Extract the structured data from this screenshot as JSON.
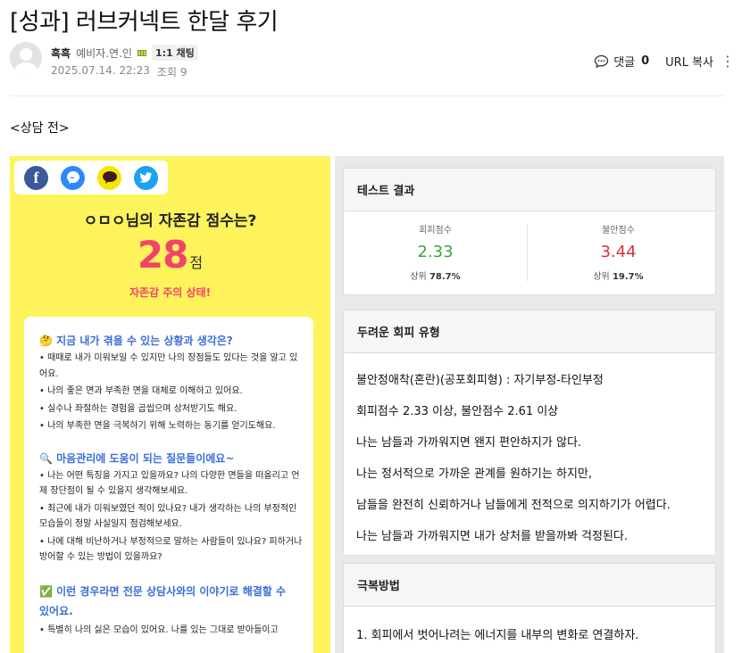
{
  "post": {
    "title": "[성과] 러브커넥트 한달 후기",
    "author": "흑흑",
    "grade": "예비자.연.인",
    "chat_badge": "1:1 채팅",
    "date": "2025.07.14. 22:23",
    "views": "조회 9",
    "comments_label": "댓글",
    "comments_count": "0",
    "url_copy": "URL 복사",
    "section_label": "<상담 전>"
  },
  "left_panel": {
    "score_title": "ㅇㅁㅇ님의 자존감 점수는?",
    "score": "28",
    "score_unit": "점",
    "state": "자존감 주의 상태!",
    "sections": [
      {
        "emoji": "🤔",
        "heading": "지금 내가 겪을 수 있는 상황과 생각은?",
        "lines": [
          "• 때때로 내가 미워보일 수 있지만 나의 장점들도 있다는 것을 알고 있어요.",
          "• 나의 좋은 면과 부족한 면을 대체로 이해하고 있어요.",
          "• 실수나 좌절하는 경험을 곱씹으며 상처받기도 해요.",
          "• 나의 부족한 면을 극복하기 위해 노력하는 동기를 얻기도해요."
        ]
      },
      {
        "emoji": "🔍",
        "heading": "마음관리에 도움이 되는 질문들이에요~",
        "lines": [
          "• 나는 어떤 특징을 가지고 있을까요? 나의 다양한 면들을 떠올리고 언제 장단점이 될 수 있을지 생각해보세요.",
          "• 최근에 내가 미워보였던 적이 있나요? 내가 생각하는 나의 부정적인 모습들이 정말 사실일지 점검해보세요.",
          "• 나에 대해 비난하거나 부정적으로 말하는 사람들이 있나요? 피하거나 방어할 수 있는 방법이 있을까요?"
        ]
      },
      {
        "emoji": "✅",
        "heading": "이런 경우라면 전문 상담사와의 이야기로 해결할 수 있어요.",
        "lines": [
          "• 특별히 나의 싫은 모습이 있어요. 나를 있는 그대로 받아들이고"
        ]
      }
    ]
  },
  "right_panel": {
    "test_result": {
      "title": "테스트 결과",
      "avoid": {
        "label": "회피점수",
        "value": "2.33",
        "rank_prefix": "상위",
        "rank": "78.7%"
      },
      "anxiety": {
        "label": "불안점수",
        "value": "3.44",
        "rank_prefix": "상위",
        "rank": "19.7%"
      }
    },
    "type_box": {
      "title": "두려운 회피 유형",
      "lines": [
        "불안정애착(혼란)(공포회피형) : 자기부정-타인부정",
        "회피점수 2.33 이상, 불안점수 2.61 이상",
        "나는 남들과 가까워지면 왠지 편안하지가 않다.",
        "나는 정서적으로 가까운 관계를 원하기는 하지만,",
        "남들을 완전히 신뢰하거나 남들에게 전적으로 의지하기가 어렵다.",
        "나는 남들과 가까워지면 내가 상처를 받을까봐 걱정된다."
      ]
    },
    "overcome_box": {
      "title": "극복방법",
      "lines": [
        "1. 회피에서 벗어나려는 에너지를 내부의 변화로 연결하자."
      ]
    }
  },
  "colors": {
    "yellow_panel": "#fff35c",
    "score_pink": "#f2436a",
    "heading_blue": "#3a6ed8",
    "green": "#3da53d",
    "red": "#d9303c"
  },
  "icons": [
    "avatar-default",
    "grade-icon",
    "comment-icon",
    "more-vertical-icon",
    "facebook-icon",
    "messenger-icon",
    "kakaotalk-icon",
    "twitter-icon"
  ]
}
